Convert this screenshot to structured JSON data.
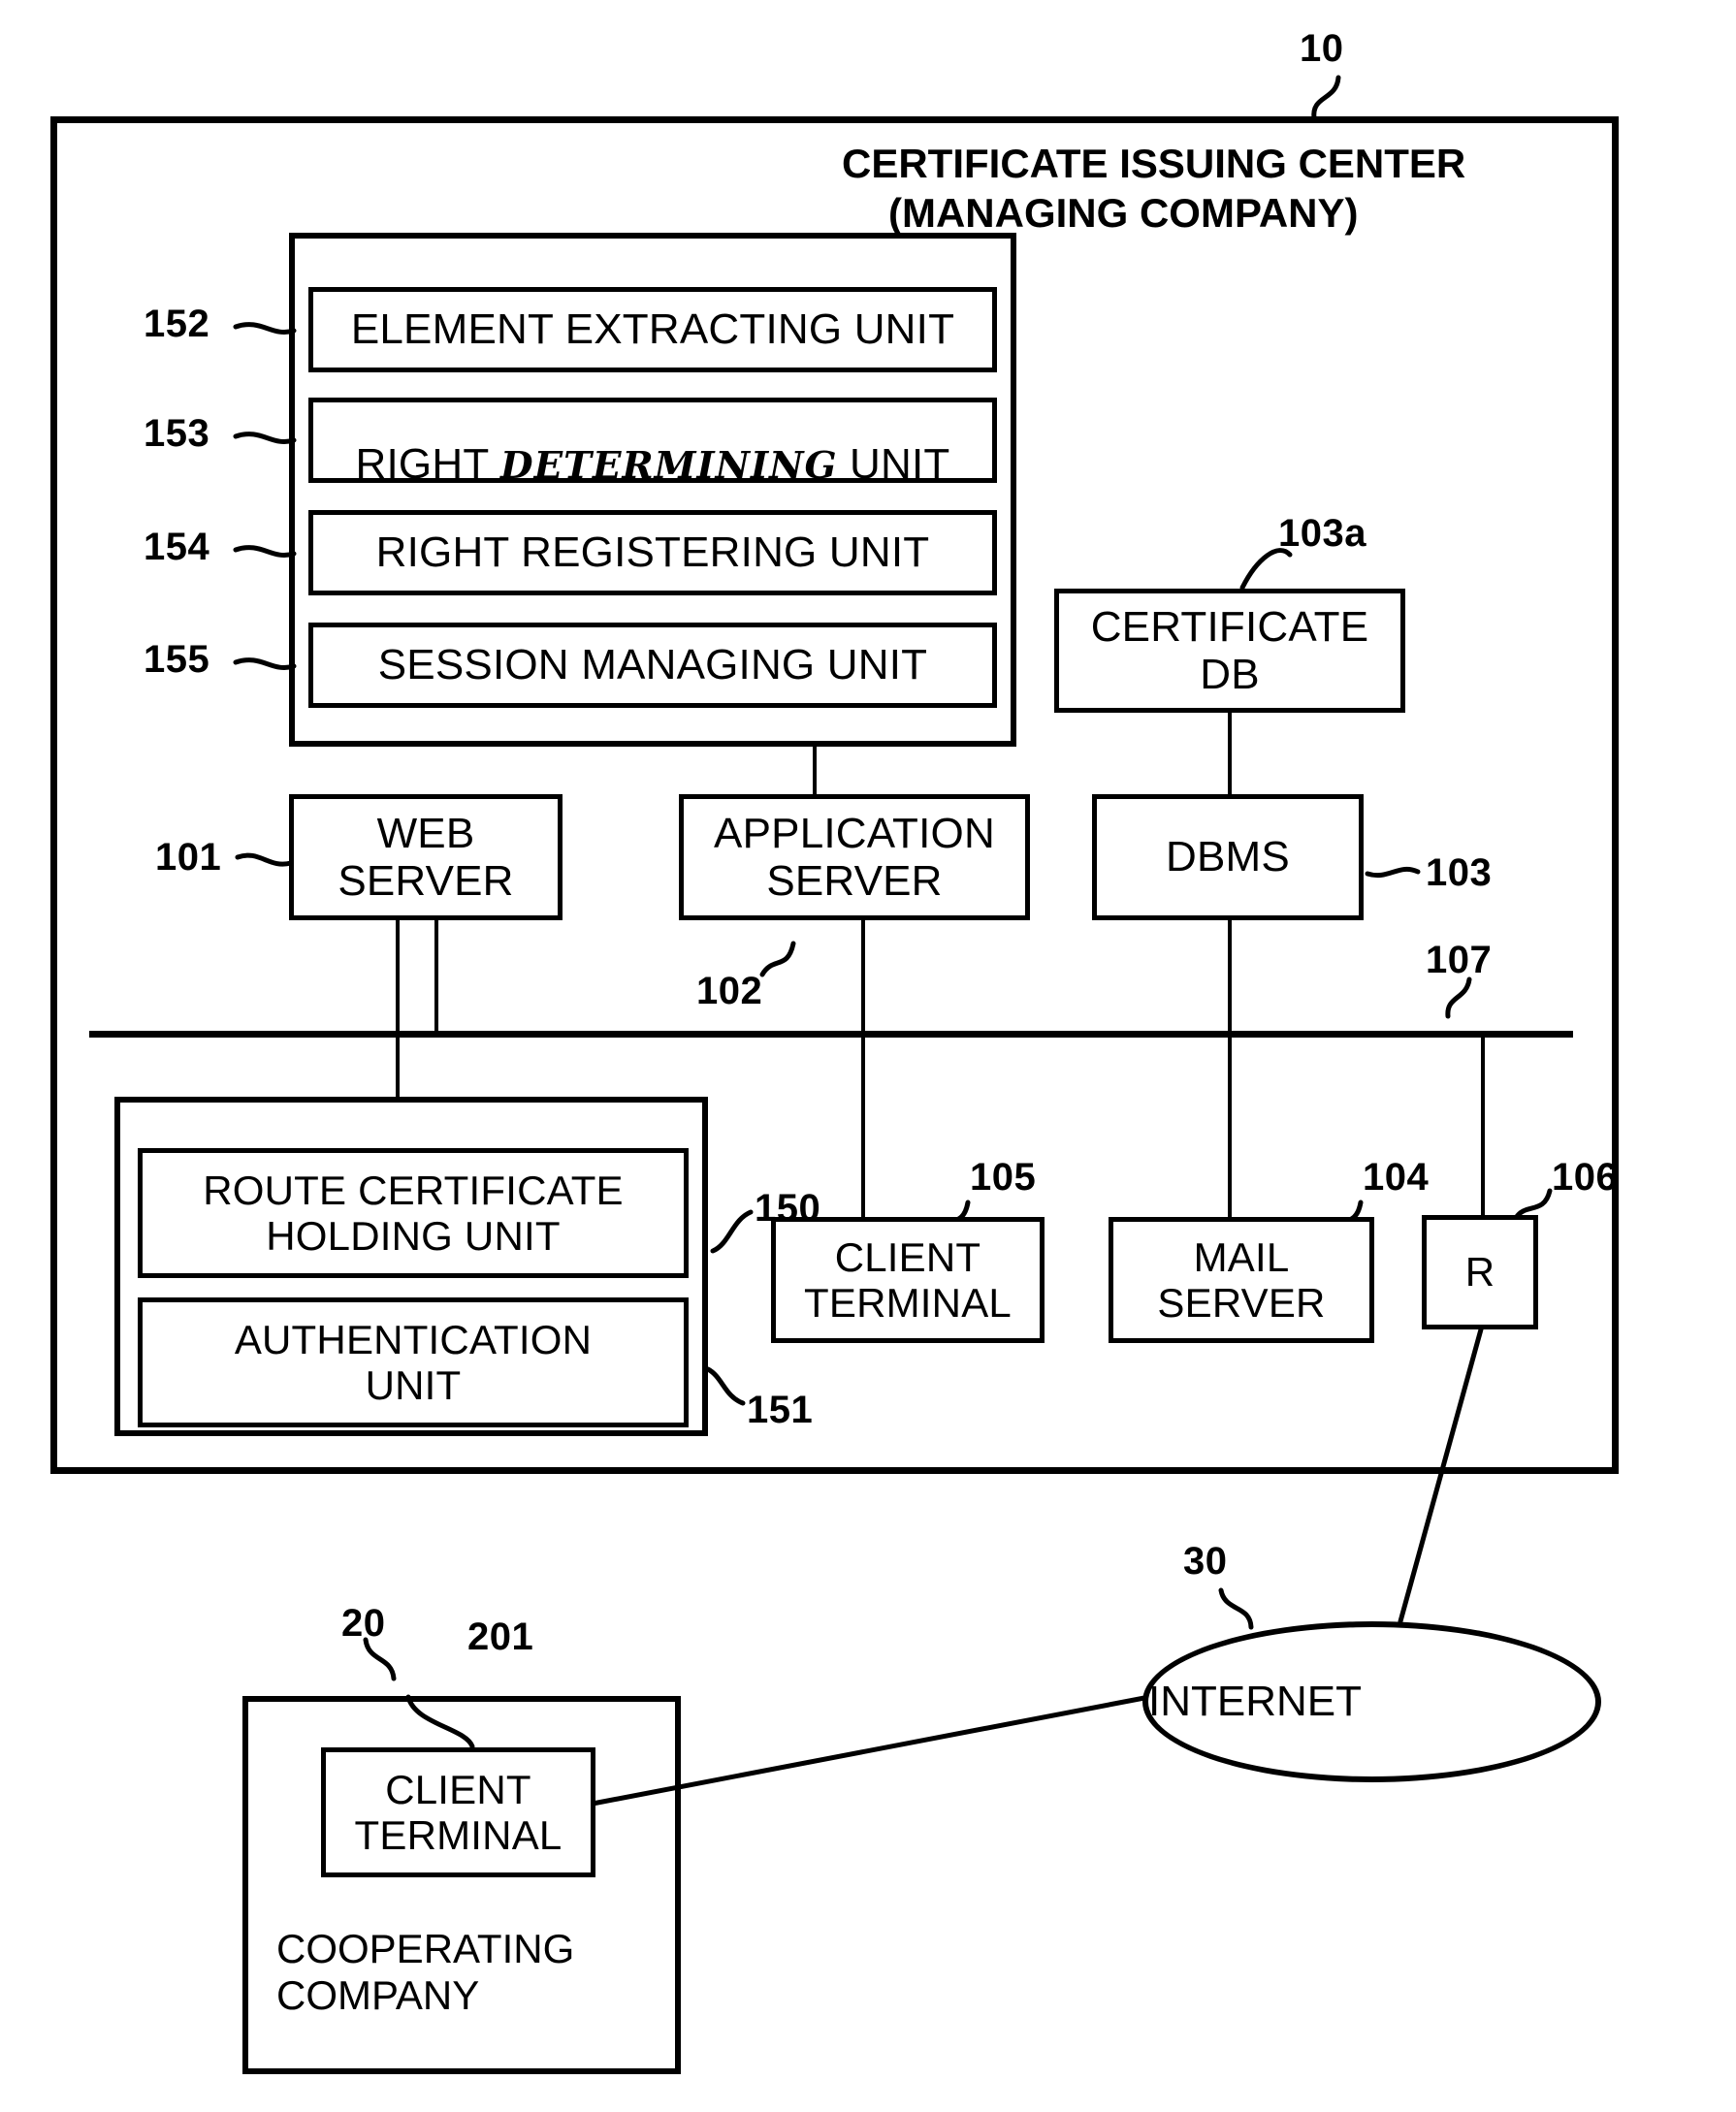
{
  "figure": {
    "center": {
      "ref": "10",
      "title_line1": "CERTIFICATE ISSUING CENTER",
      "title_line2": "(MANAGING COMPANY)"
    },
    "app_server_units": {
      "items": [
        {
          "ref": "152",
          "label": "ELEMENT EXTRACTING UNIT"
        },
        {
          "ref": "153",
          "label_pre": "RIGHT ",
          "label_hand": "DETERMINING",
          "label_post": " UNIT",
          "label": "RIGHT DETERMINING UNIT"
        },
        {
          "ref": "154",
          "label": "RIGHT REGISTERING UNIT"
        },
        {
          "ref": "155",
          "label": "SESSION MANAGING UNIT"
        }
      ]
    },
    "certificate_db": {
      "ref": "103a",
      "label": "CERTIFICATE\nDB"
    },
    "servers": [
      {
        "ref": "101",
        "label": "WEB\nSERVER"
      },
      {
        "ref": "102",
        "label": "APPLICATION\nSERVER"
      },
      {
        "ref": "103",
        "label": "DBMS"
      }
    ],
    "bus": {
      "ref": "107"
    },
    "web_server_units": {
      "items": [
        {
          "ref": "150",
          "label": "ROUTE CERTIFICATE\nHOLDING UNIT"
        },
        {
          "ref": "151",
          "label": "AUTHENTICATION\nUNIT"
        }
      ]
    },
    "nodes": [
      {
        "ref": "105",
        "label": "CLIENT\nTERMINAL"
      },
      {
        "ref": "104",
        "label": "MAIL\nSERVER"
      },
      {
        "ref": "106",
        "label": "R"
      }
    ],
    "internet": {
      "ref": "30",
      "label": "INTERNET"
    },
    "cooperating_company": {
      "ref": "20",
      "label": "COOPERATING\nCOMPANY",
      "client_terminal": {
        "ref": "201",
        "label": "CLIENT\nTERMINAL"
      }
    }
  }
}
